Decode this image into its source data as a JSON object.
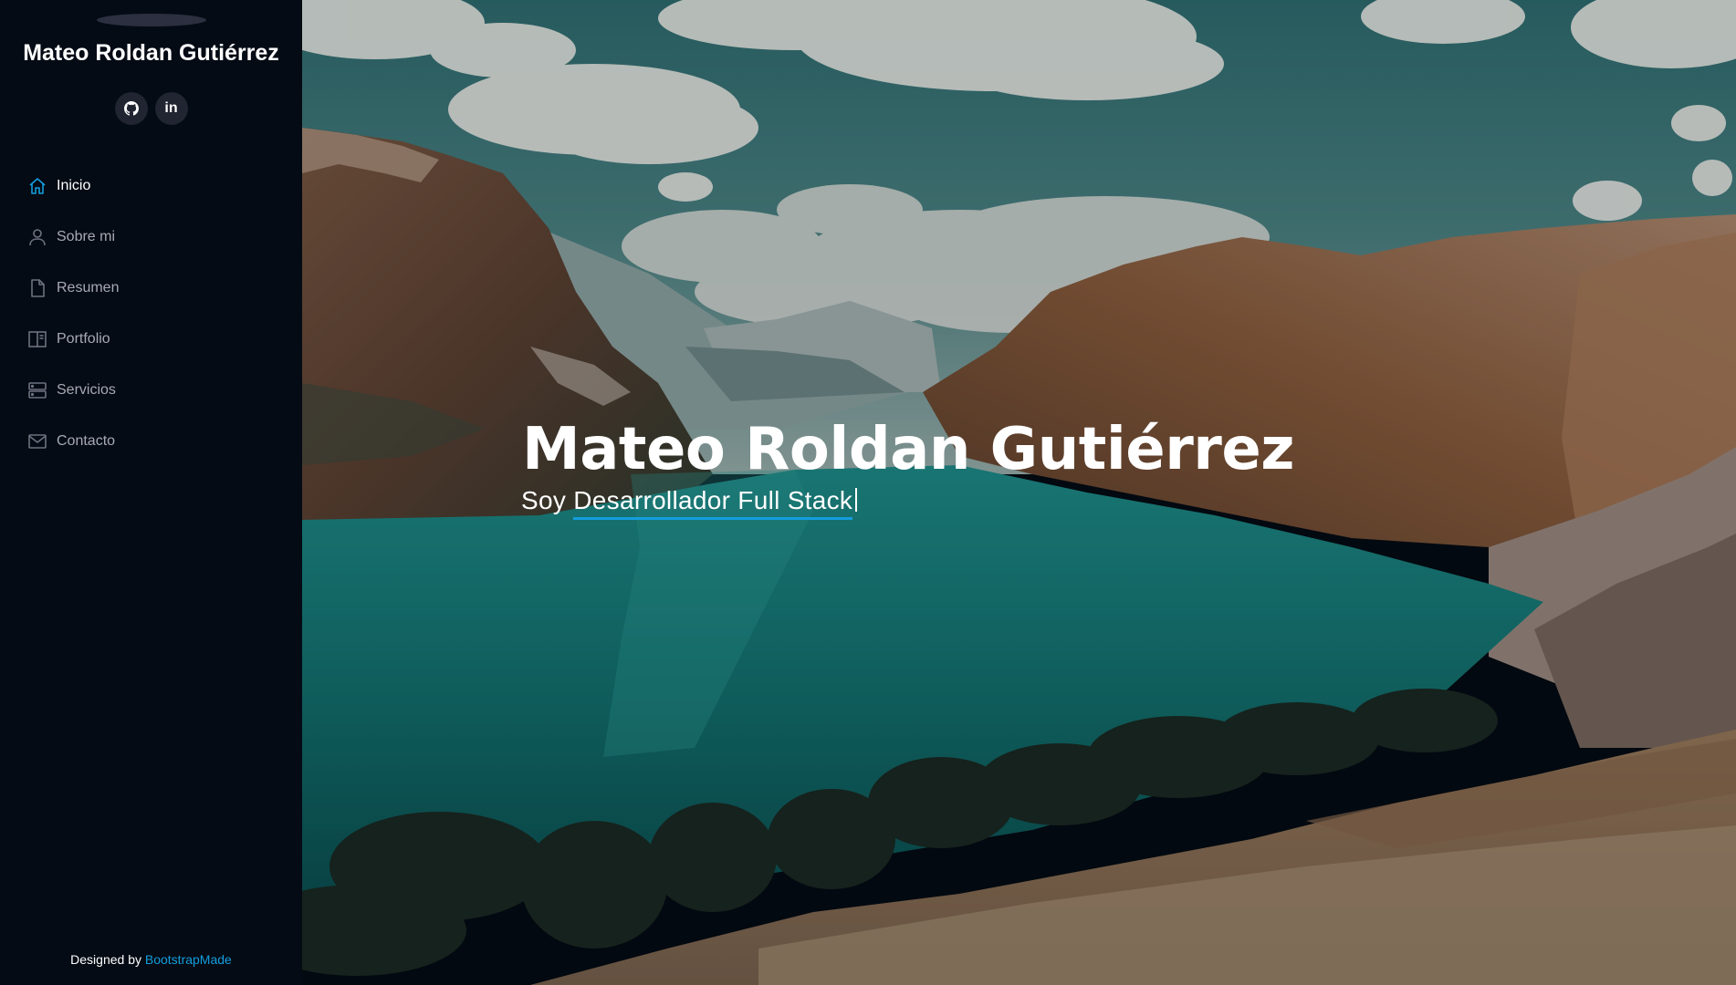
{
  "profile": {
    "name": "Mateo Roldan Gutiérrez"
  },
  "social": [
    {
      "icon": "github-icon",
      "label": ""
    },
    {
      "icon": "linkedin-icon",
      "label": "in"
    }
  ],
  "nav": {
    "items": [
      {
        "label": "Inicio",
        "icon": "home-icon",
        "active": true
      },
      {
        "label": "Sobre mi",
        "icon": "person-icon",
        "active": false
      },
      {
        "label": "Resumen",
        "icon": "file-icon",
        "active": false
      },
      {
        "label": "Portfolio",
        "icon": "book-icon",
        "active": false
      },
      {
        "label": "Servicios",
        "icon": "server-icon",
        "active": false
      },
      {
        "label": "Contacto",
        "icon": "envelope-icon",
        "active": false
      }
    ]
  },
  "footer": {
    "prefix": "Designed by",
    "link_text": "BootstrapMade"
  },
  "hero": {
    "title": "Mateo Roldan Gutiérrez",
    "subtitle_prefix": "Soy",
    "subtitle_role": "Desarrollador Full Stack"
  },
  "colors": {
    "sidebar_bg": "#040b14",
    "accent": "#149ddd",
    "nav_text": "#a8a9b4",
    "social_bg": "#212431"
  }
}
